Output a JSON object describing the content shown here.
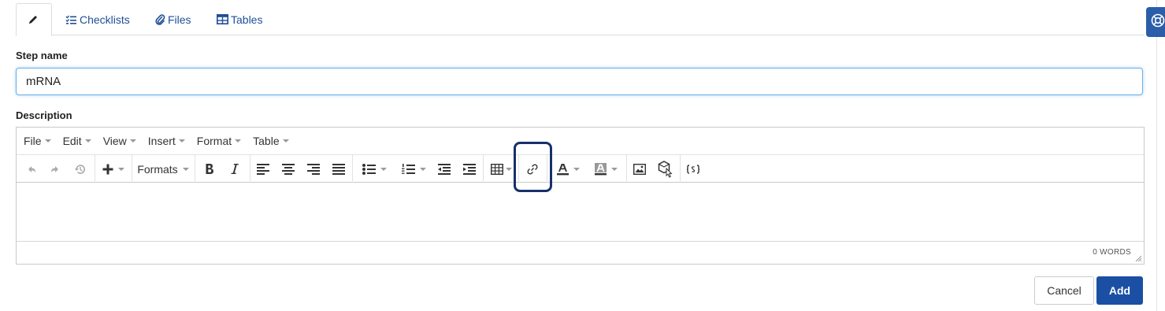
{
  "tabs": [
    {
      "id": "edit",
      "label": "",
      "icon": "pencil-icon",
      "active": true
    },
    {
      "id": "checklists",
      "label": "Checklists",
      "icon": "checklist-icon"
    },
    {
      "id": "files",
      "label": "Files",
      "icon": "paperclip-icon"
    },
    {
      "id": "tables",
      "label": "Tables",
      "icon": "table-icon"
    }
  ],
  "form": {
    "step_name_label": "Step name",
    "step_name_value": "mRNA",
    "description_label": "Description"
  },
  "editor": {
    "menu": [
      "File",
      "Edit",
      "View",
      "Insert",
      "Format",
      "Table"
    ],
    "formats_label": "Formats",
    "word_count": "0 WORDS",
    "toolbar_icons": [
      "undo-icon",
      "redo-icon",
      "history-icon",
      "plus-icon",
      "bold-icon",
      "italic-icon",
      "align-left-icon",
      "align-center-icon",
      "align-right-icon",
      "align-justify-icon",
      "bullet-list-icon",
      "numbered-list-icon",
      "outdent-icon",
      "indent-icon",
      "table-icon",
      "link-icon",
      "text-color-icon",
      "background-color-icon",
      "image-icon",
      "smart-annotation-icon",
      "code-icon"
    ]
  },
  "buttons": {
    "cancel": "Cancel",
    "add": "Add"
  },
  "colors": {
    "accent": "#1b4fa3",
    "highlight_border": "#17306b",
    "tab_link": "#1f4e96",
    "input_focus": "#66afe9"
  }
}
